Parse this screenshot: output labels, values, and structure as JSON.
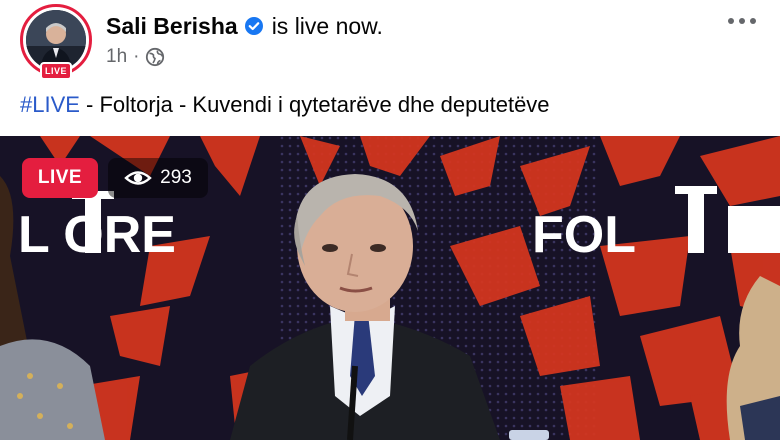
{
  "post": {
    "author": "Sali Berisha",
    "status": "is live now.",
    "time": "1h",
    "separator": "·",
    "avatar_live_label": "LIVE",
    "caption_hashtag": "#LIVE",
    "caption_rest": " - Foltorja - Kuvendi i qytetarëve dhe deputetëve"
  },
  "video": {
    "live_label": "LIVE",
    "viewers": "293",
    "backdrop_left_text": "L  ORE",
    "backdrop_right_text": "FOL"
  },
  "icons": {
    "verified": "verified-badge-icon",
    "privacy": "globe-icon",
    "more": "more-horizontal-icon",
    "viewers": "eye-icon"
  },
  "colors": {
    "live_red": "#e41e3f",
    "hashtag_blue": "#2a5ac9",
    "verified_blue": "#1877f2",
    "meta_gray": "#65676b",
    "backdrop_red": "#d8361e",
    "backdrop_dark": "#171226"
  }
}
